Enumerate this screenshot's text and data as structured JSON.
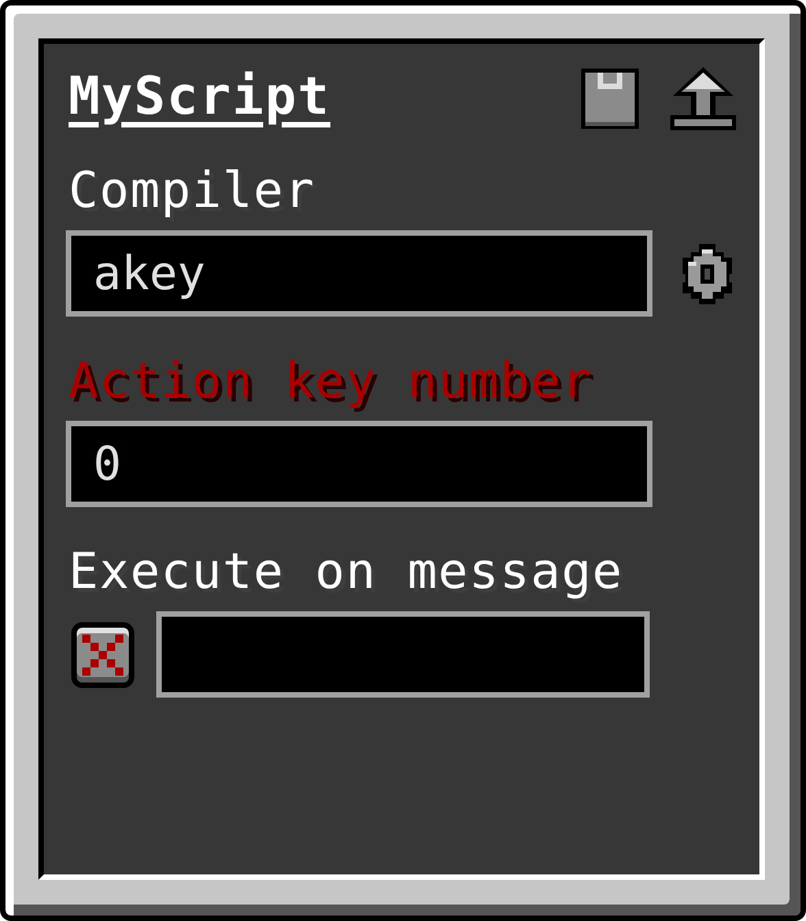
{
  "window": {
    "title": "MyScript"
  },
  "compiler": {
    "label": "Compiler",
    "value": "akey",
    "invalid": false
  },
  "action_key": {
    "label": "Action key number",
    "value": "0",
    "invalid": true
  },
  "execute_on_message": {
    "label": "Execute on message",
    "checked": false
  }
}
